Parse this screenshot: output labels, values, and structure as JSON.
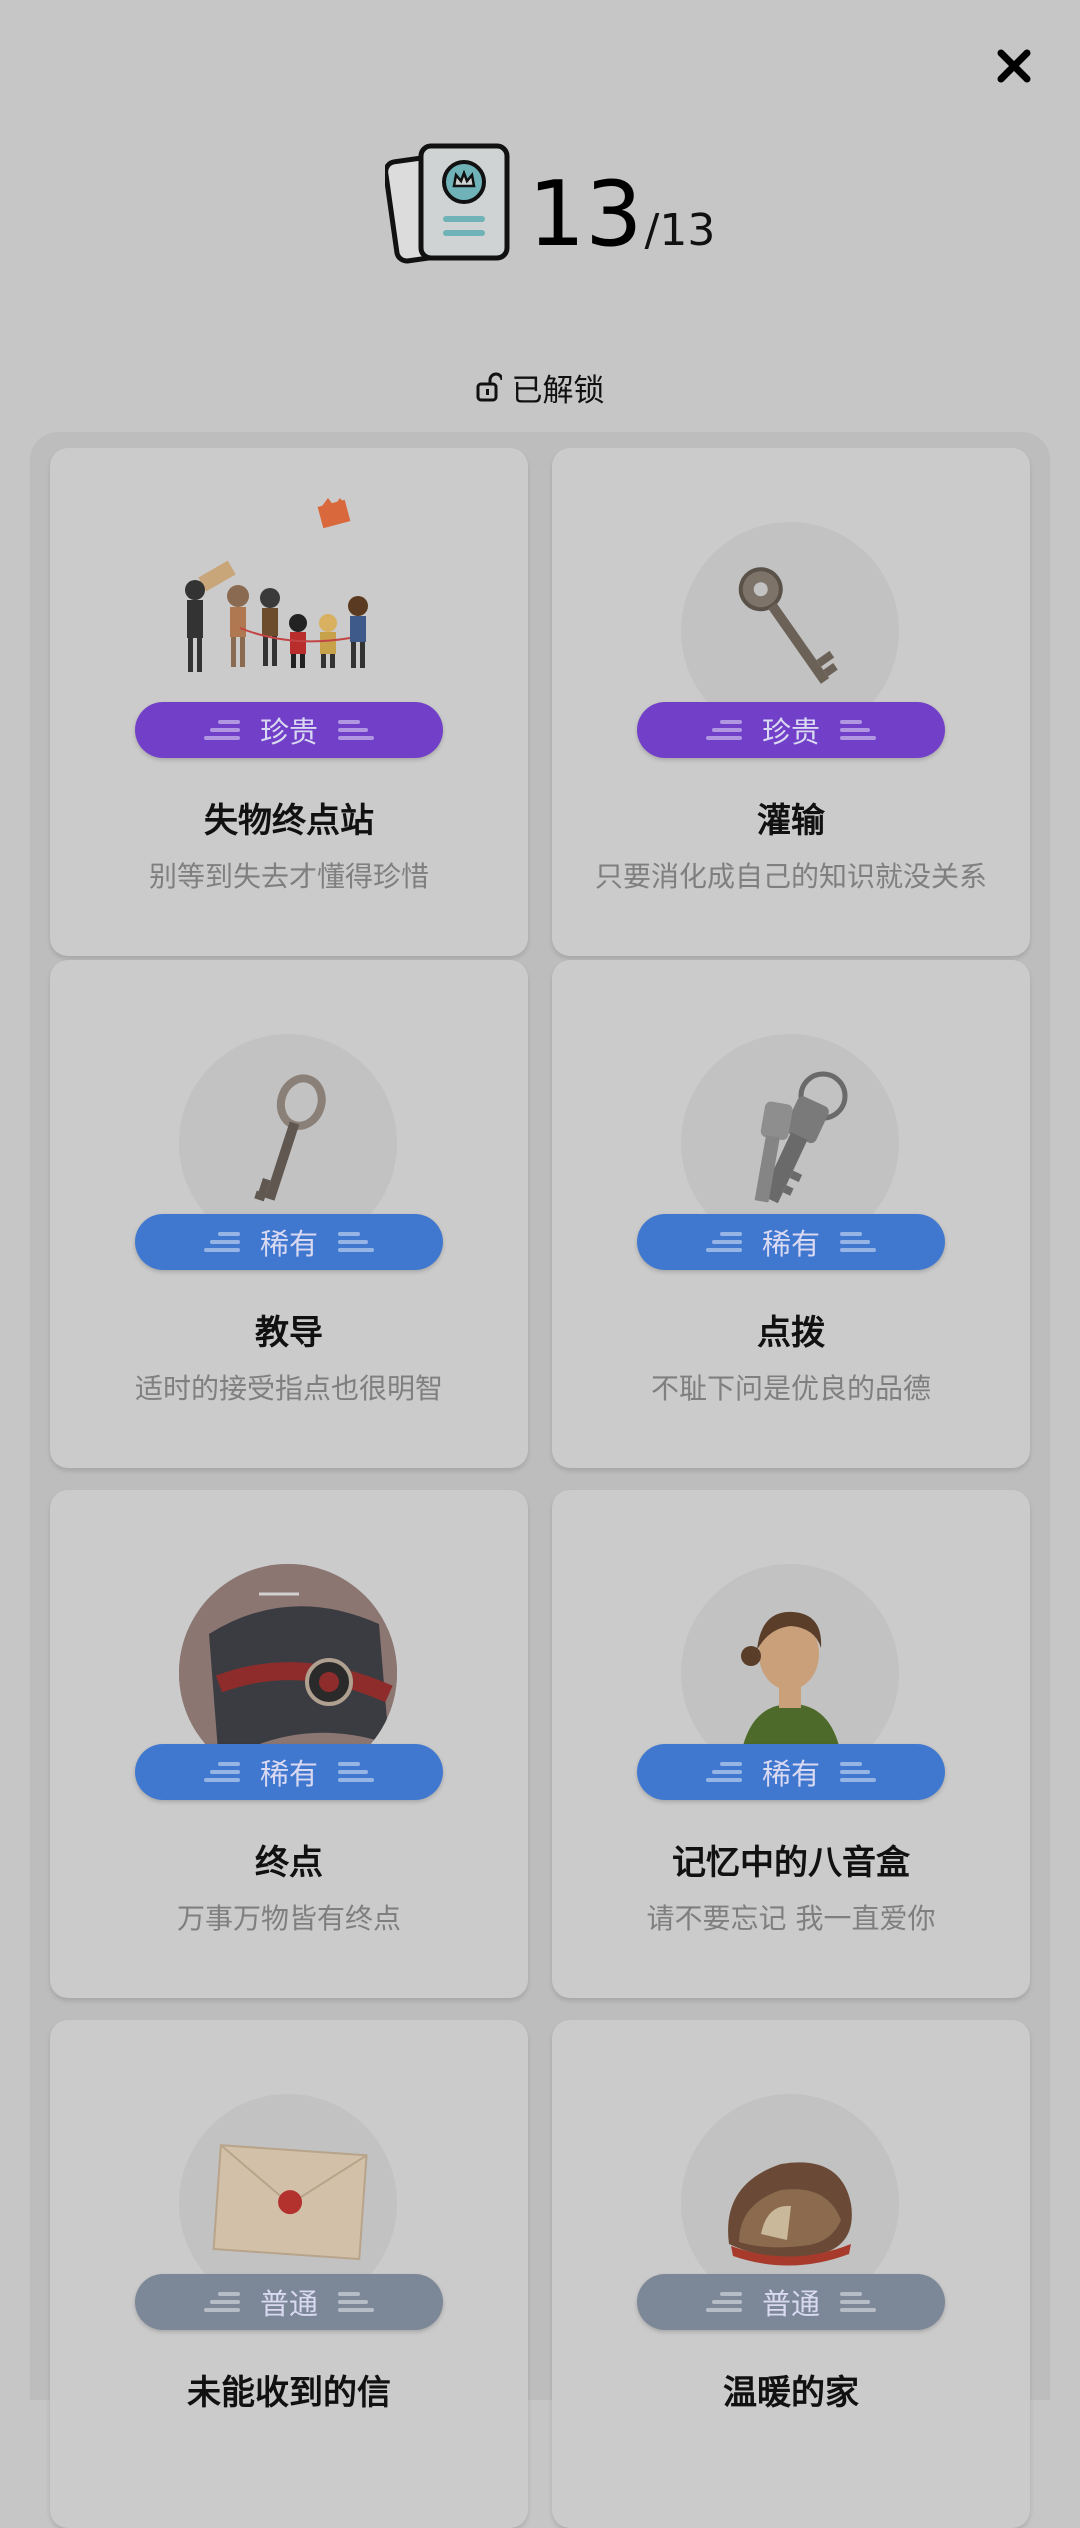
{
  "header": {
    "count": "13",
    "total": "/13",
    "unlock_label": "已解锁"
  },
  "colors": {
    "precious": "#7240c8",
    "rare": "#4178cf",
    "normal": "#7c8797"
  },
  "cards": [
    {
      "title": "失物终点站",
      "desc": "别等到失去才懂得珍惜",
      "badge": "珍贵",
      "art": "group-of-people-illustration"
    },
    {
      "title": "灌输",
      "desc": "只要消化成自己的知识就没关系",
      "badge": "珍贵",
      "art": "old-key-icon"
    },
    {
      "title": "教导",
      "desc": "适时的接受指点也很明智",
      "badge": "稀有",
      "art": "skeleton-key-icon"
    },
    {
      "title": "点拨",
      "desc": "不耻下问是优良的品德",
      "badge": "稀有",
      "art": "key-ring-icon"
    },
    {
      "title": "终点",
      "desc": "万事万物皆有终点",
      "badge": "稀有",
      "art": "conductor-cap-icon"
    },
    {
      "title": "记忆中的八音盒",
      "desc": "请不要忘记 我一直爱你",
      "badge": "稀有",
      "art": "woman-portrait-icon"
    },
    {
      "title": "未能收到的信",
      "desc": "",
      "badge": "普通",
      "art": "sealed-envelope-icon"
    },
    {
      "title": "温暖的家",
      "desc": "",
      "badge": "普通",
      "art": "rock-house-icon"
    }
  ]
}
